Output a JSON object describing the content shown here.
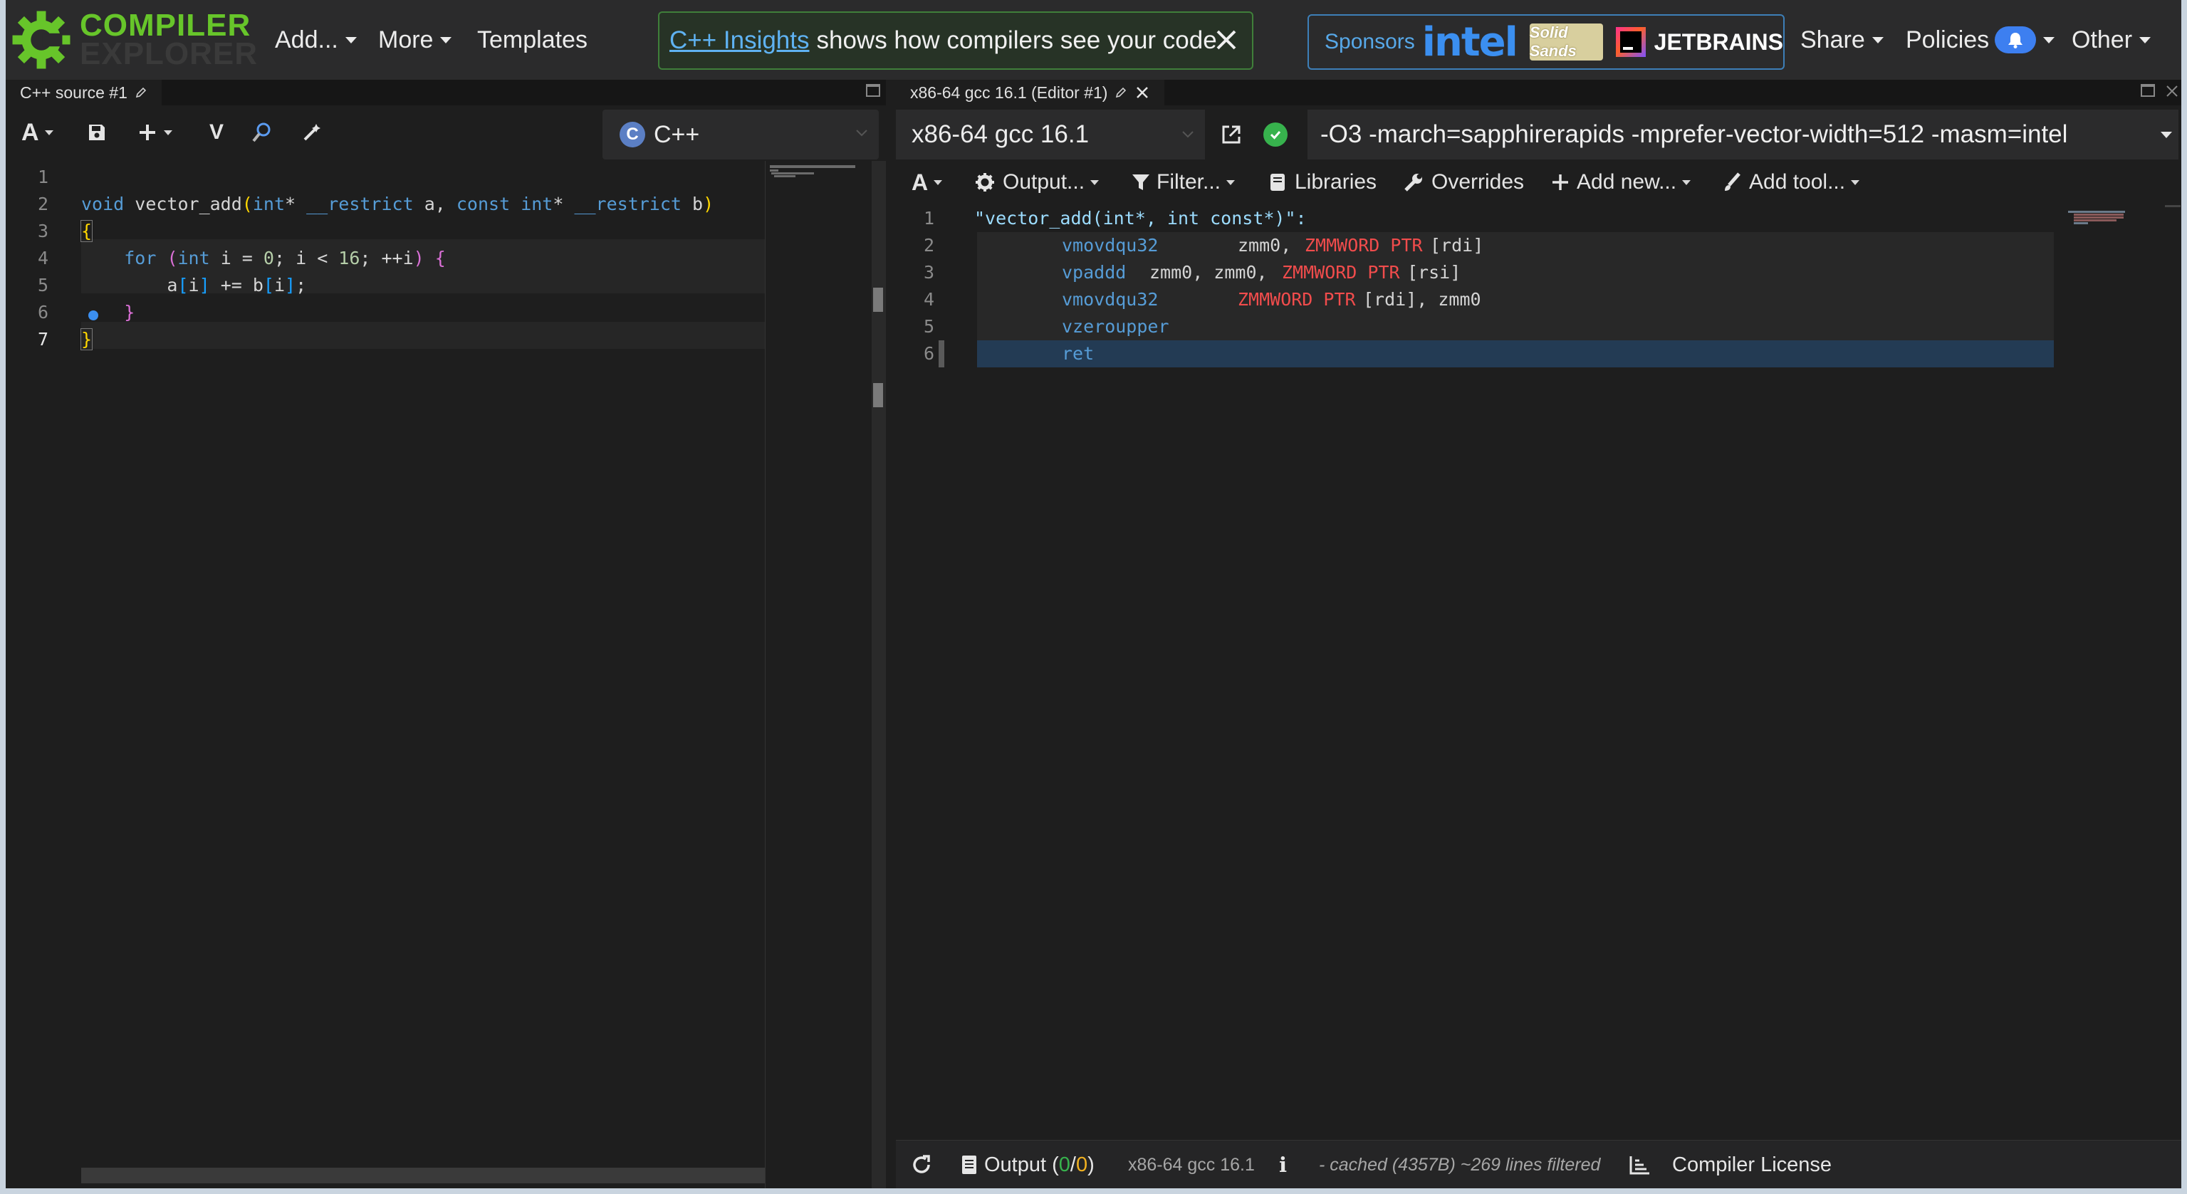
{
  "nav": {
    "logo_line1": "COMPILER",
    "logo_line2": "EXPLORER",
    "add": "Add...",
    "more": "More",
    "templates": "Templates",
    "insights_link": "C++ Insights",
    "insights_text": "shows how compilers see your code",
    "sponsors_label": "Sponsors",
    "sponsor_intel": "intel",
    "sponsor_solid": "Solid Sands",
    "sponsor_jetbrains": "JETBRAINS",
    "share": "Share",
    "policies": "Policies",
    "other": "Other"
  },
  "source_panel": {
    "tab_title": "C++ source #1",
    "language": "C++",
    "vim_label": "V",
    "lines": [
      "",
      "void vector_add(int* __restrict a, const int* __restrict b)",
      "{",
      "    for (int i = 0; i < 16; ++i) {",
      "        a[i] += b[i];",
      "    }",
      "}"
    ],
    "line_numbers": [
      "1",
      "2",
      "3",
      "4",
      "5",
      "6",
      "7"
    ]
  },
  "compiler_panel": {
    "tab_title": "x86-64 gcc 16.1 (Editor #1)",
    "compiler": "x86-64 gcc 16.1",
    "flags": "-O3 -march=sapphirerapids -mprefer-vector-width=512 -masm=intel",
    "toolbar": {
      "output": "Output...",
      "filter": "Filter...",
      "libraries": "Libraries",
      "overrides": "Overrides",
      "add_new": "Add new...",
      "add_tool": "Add tool..."
    },
    "asm_line_numbers": [
      "1",
      "2",
      "3",
      "4",
      "5",
      "6"
    ],
    "asm": {
      "label": "\"vector_add(int*, int const*)\":",
      "l2_instr": "vmovdqu32",
      "l2_a": "zmm0,",
      "l2_b": "ZMMWORD PTR",
      "l2_c": "[rdi]",
      "l3_instr": "vpaddd",
      "l3_a": "zmm0, zmm0,",
      "l3_b": "ZMMWORD PTR",
      "l3_c": "[rsi]",
      "l4_instr": "vmovdqu32",
      "l4_b": "ZMMWORD PTR",
      "l4_c": "[rdi], zmm0",
      "l5_instr": "vzeroupper",
      "l6_instr": "ret"
    },
    "bottom": {
      "output_label": "Output (",
      "output_ok": "0",
      "output_sep": "/",
      "output_err": "0",
      "output_close": ")",
      "compiler_name": "x86-64 gcc 16.1",
      "info": "i",
      "cache_info": "- cached (4357B) ~269 lines filtered",
      "license": "Compiler License"
    }
  },
  "colors": {
    "accent_green": "#67c52a",
    "link_blue": "#5fb2f2",
    "status_ok": "#37b24d",
    "keyword": "#569cd6",
    "ptr_red": "#f14c4c"
  }
}
